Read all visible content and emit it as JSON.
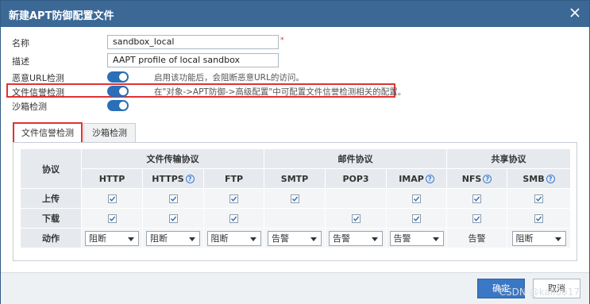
{
  "dialog": {
    "title": "新建APT防御配置文件"
  },
  "form": {
    "name_label": "名称",
    "name_value": "sandbox_local",
    "required_mark": "*",
    "desc_label": "描述",
    "desc_value": "AAPT profile of local sandbox",
    "malicious_url_label": "恶意URL检测",
    "malicious_url_hint": "启用该功能后，会阻断恶意URL的访问。",
    "file_rep_label": "文件信誉检测",
    "file_rep_hint": "在\"对象->APT防御->高级配置\"中可配置文件信誉检测相关的配置。",
    "sandbox_label": "沙箱检测"
  },
  "tabs": [
    {
      "label": "文件信誉检测",
      "active": true
    },
    {
      "label": "沙箱检测",
      "active": false
    }
  ],
  "table": {
    "protocol_header": "协议",
    "groups": [
      {
        "label": "文件传输协议"
      },
      {
        "label": "邮件协议"
      },
      {
        "label": "共享协议"
      }
    ],
    "columns": [
      {
        "label": "HTTP",
        "help": false
      },
      {
        "label": "HTTPS",
        "help": true
      },
      {
        "label": "FTP",
        "help": false
      },
      {
        "label": "SMTP",
        "help": false
      },
      {
        "label": "POP3",
        "help": false
      },
      {
        "label": "IMAP",
        "help": true
      },
      {
        "label": "NFS",
        "help": true
      },
      {
        "label": "SMB",
        "help": true
      }
    ],
    "help_glyph": "?",
    "upload_label": "上传",
    "download_label": "下载",
    "action_label": "动作",
    "upload": [
      true,
      true,
      true,
      true,
      false,
      true,
      true,
      true
    ],
    "download": [
      true,
      true,
      true,
      false,
      true,
      true,
      true,
      true
    ],
    "actions": [
      {
        "value": "阻断",
        "select": true
      },
      {
        "value": "阻断",
        "select": true
      },
      {
        "value": "阻断",
        "select": true
      },
      {
        "value": "告警",
        "select": true
      },
      {
        "value": "告警",
        "select": true
      },
      {
        "value": "告警",
        "select": true
      },
      {
        "value": "告警",
        "select": false
      },
      {
        "value": "阻断",
        "select": true
      }
    ]
  },
  "footer": {
    "ok_label": "确定",
    "cancel_label": "取消",
    "watermark": "CSDN @kali0617"
  },
  "colors": {
    "titlebar": "#3c6896",
    "accent": "#2a6fb8",
    "highlight": "#e03232"
  }
}
